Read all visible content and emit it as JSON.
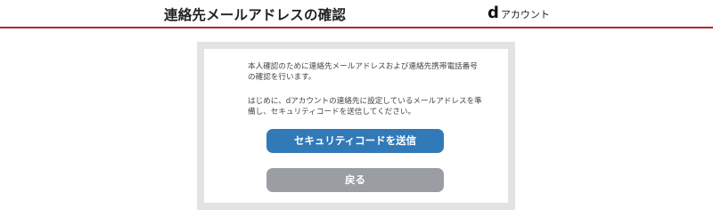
{
  "header": {
    "title": "連絡先メールアドレスの確認",
    "brand_mark": "d",
    "brand_text": "アカウント",
    "accent_color": "#b3262a"
  },
  "panel": {
    "paragraph_1": "本人確認のために連絡先メールアドレスおよび連絡先携帯電話番号の確認を行います。",
    "paragraph_2": "はじめに、dアカウントの連絡先に設定しているメールアドレスを準備し、セキュリティコードを送信してください。"
  },
  "buttons": {
    "send_label": "セキュリティコードを送信",
    "send_color": "#3279b8",
    "back_label": "戻る",
    "back_color": "#9a9ea3"
  }
}
